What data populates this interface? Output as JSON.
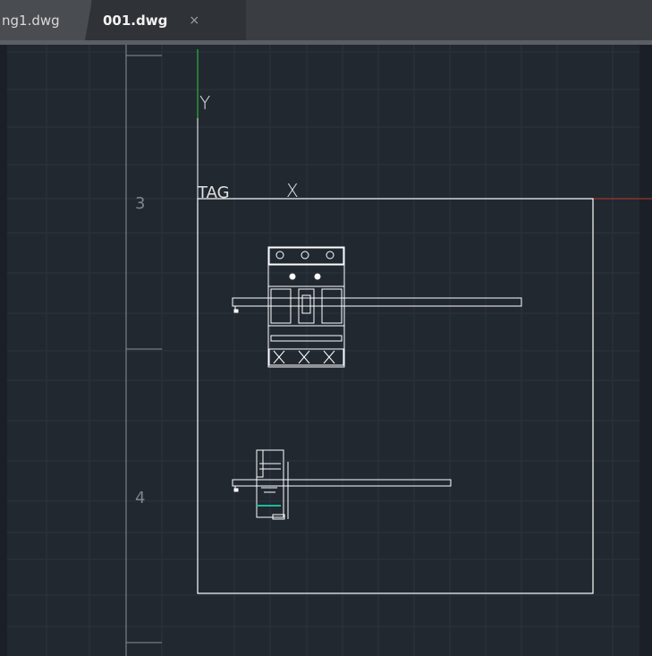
{
  "tabs": [
    {
      "label": "ng1.dwg",
      "active": false
    },
    {
      "label": "001.dwg",
      "active": true,
      "close": "×"
    }
  ],
  "ruler": {
    "labels": [
      "3",
      "4"
    ]
  },
  "ucs": {
    "y_label": "Y",
    "x_label": "X"
  },
  "drawing": {
    "tag_label": "TAG"
  },
  "colors": {
    "background": "#212830",
    "grid": "#2b3340",
    "linework": "#ffffff",
    "x_axis": "#c0392b",
    "y_axis": "#2ecc40",
    "accent": "#1abc9c"
  }
}
